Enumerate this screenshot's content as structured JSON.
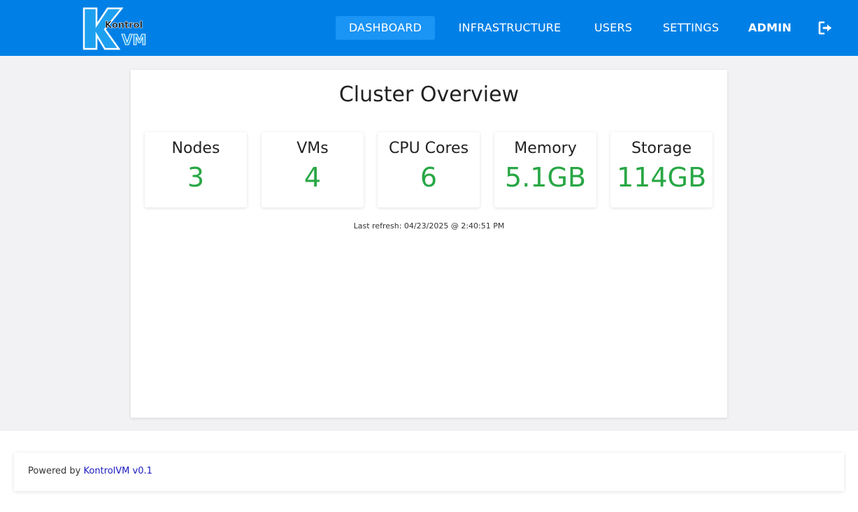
{
  "brand": {
    "logo_word_top": "Kontrol",
    "logo_word_bottom": "VM",
    "color": "#0080e6"
  },
  "nav": {
    "dashboard": "DASHBOARD",
    "infrastructure": "INFRASTRUCTURE",
    "users": "USERS",
    "settings": "SETTINGS",
    "admin": "ADMIN",
    "logout_icon": "sign-out-icon",
    "active": "dashboard"
  },
  "overview": {
    "title": "Cluster Overview",
    "stats": [
      {
        "label": "Nodes",
        "value": "3"
      },
      {
        "label": "VMs",
        "value": "4"
      },
      {
        "label": "CPU Cores",
        "value": "6"
      },
      {
        "label": "Memory",
        "value": "5.1GB"
      },
      {
        "label": "Storage",
        "value": "114GB"
      }
    ],
    "value_color": "#28a745",
    "last_refresh": "Last refresh: 04/23/2025 @ 2:40:51 PM"
  },
  "footer": {
    "prefix": "Powered by ",
    "link": "KontrolVM v0.1"
  }
}
